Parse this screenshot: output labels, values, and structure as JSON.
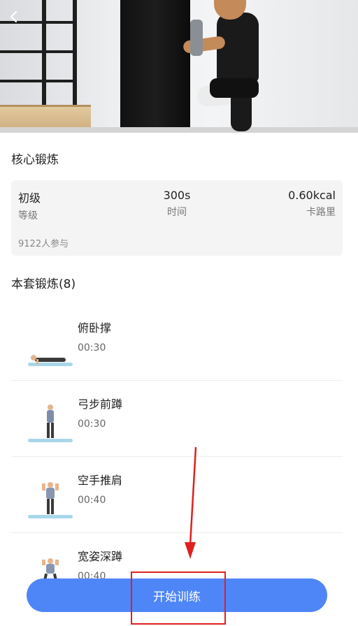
{
  "header": {
    "back_icon": "chevron-left-icon"
  },
  "workout": {
    "title": "核心锻炼",
    "stats": {
      "level_value": "初级",
      "level_label": "等级",
      "time_value": "300s",
      "time_label": "时间",
      "calorie_value": "0.60kcal",
      "calorie_label": "卡路里"
    },
    "participants": "9122人参与"
  },
  "exercises": {
    "section_title": "本套锻炼(8)",
    "items": [
      {
        "name": "俯卧撑",
        "duration": "00:30"
      },
      {
        "name": "弓步前蹲",
        "duration": "00:30"
      },
      {
        "name": "空手推肩",
        "duration": "00:40"
      },
      {
        "name": "宽姿深蹲",
        "duration": "00:40"
      }
    ]
  },
  "footer": {
    "start_label": "开始训练"
  },
  "colors": {
    "accent": "#4f86f7",
    "annotation": "#e02020"
  }
}
